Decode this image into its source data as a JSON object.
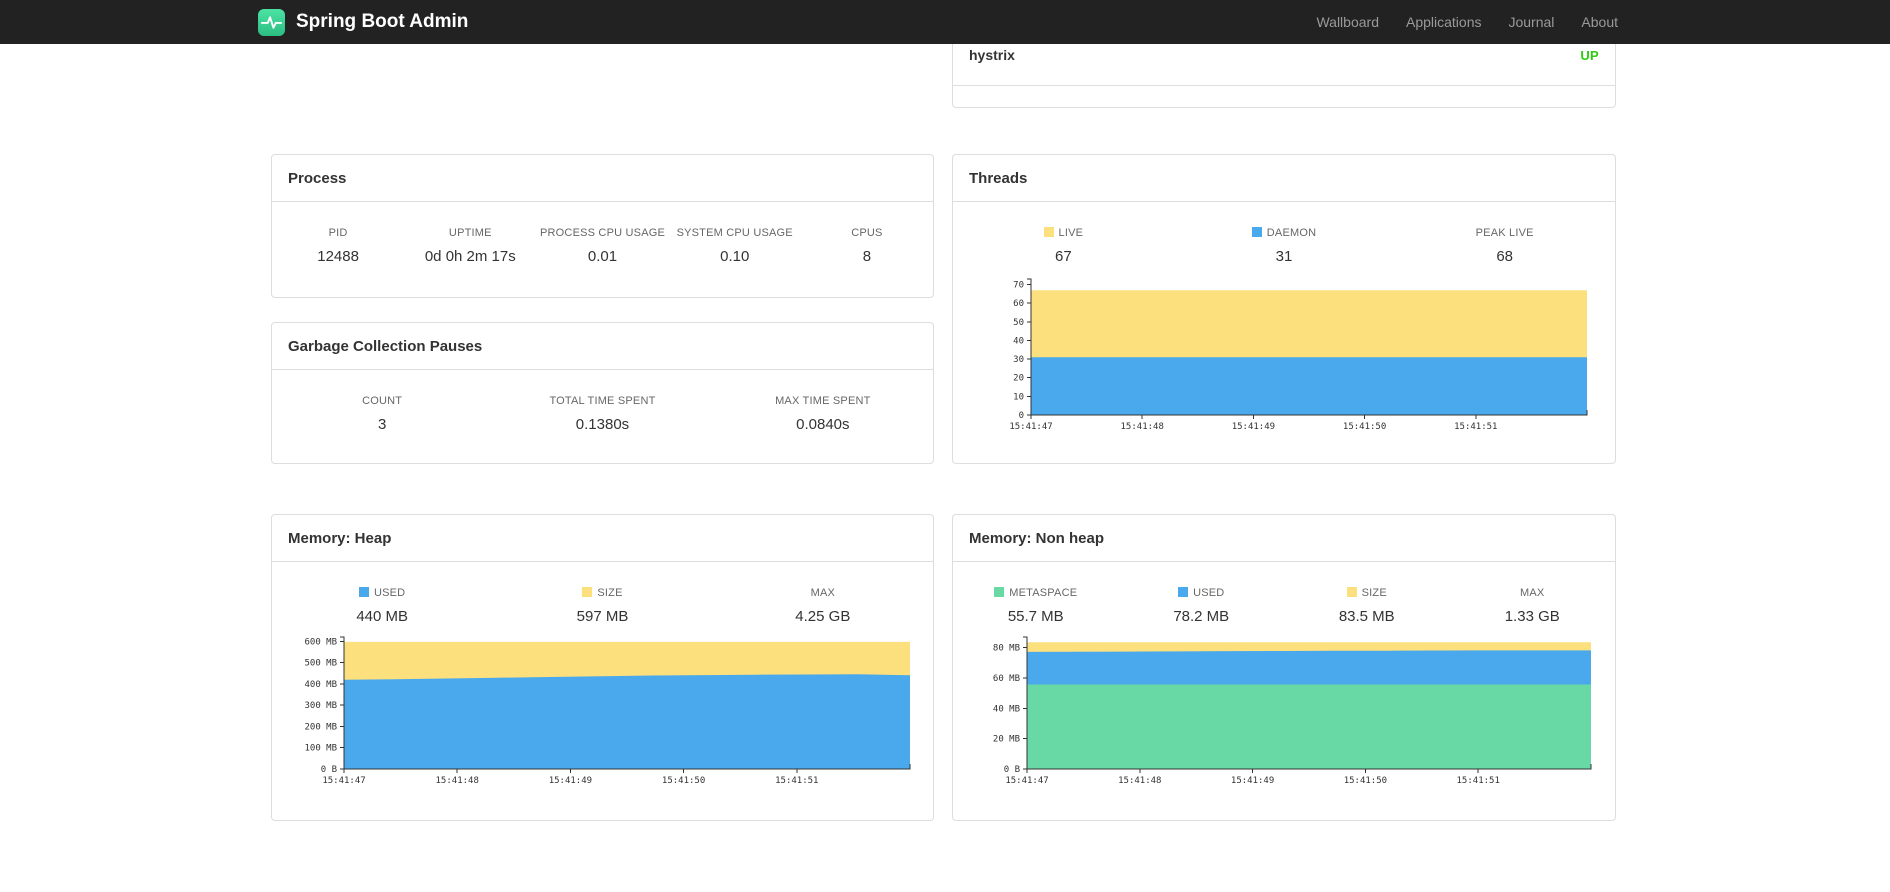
{
  "navbar": {
    "brand": "Spring Boot Admin",
    "links": [
      "Wallboard",
      "Applications",
      "Journal",
      "About"
    ]
  },
  "health": {
    "name": "hystrix",
    "status": "UP",
    "status_color": "#2ecc0e"
  },
  "process": {
    "title": "Process",
    "stats": [
      {
        "label": "PID",
        "value": "12488"
      },
      {
        "label": "UPTIME",
        "value": "0d 0h 2m 17s"
      },
      {
        "label": "PROCESS CPU USAGE",
        "value": "0.01"
      },
      {
        "label": "SYSTEM CPU USAGE",
        "value": "0.10"
      },
      {
        "label": "CPUS",
        "value": "8"
      }
    ]
  },
  "gc": {
    "title": "Garbage Collection Pauses",
    "stats": [
      {
        "label": "COUNT",
        "value": "3"
      },
      {
        "label": "TOTAL TIME SPENT",
        "value": "0.1380s"
      },
      {
        "label": "MAX TIME SPENT",
        "value": "0.0840s"
      }
    ]
  },
  "threads": {
    "title": "Threads",
    "legend": [
      {
        "label": "LIVE",
        "value": "67",
        "color": "#fce07e"
      },
      {
        "label": "DAEMON",
        "value": "31",
        "color": "#4aa9ec"
      },
      {
        "label": "PEAK LIVE",
        "value": "68"
      }
    ]
  },
  "heap": {
    "title": "Memory: Heap",
    "legend": [
      {
        "label": "USED",
        "value": "440 MB",
        "color": "#4aa9ec"
      },
      {
        "label": "SIZE",
        "value": "597 MB",
        "color": "#fce07e"
      },
      {
        "label": "MAX",
        "value": "4.25 GB"
      }
    ]
  },
  "nonheap": {
    "title": "Memory: Non heap",
    "legend": [
      {
        "label": "METASPACE",
        "value": "55.7 MB",
        "color": "#68d9a4"
      },
      {
        "label": "USED",
        "value": "78.2 MB",
        "color": "#4aa9ec"
      },
      {
        "label": "SIZE",
        "value": "83.5 MB",
        "color": "#fce07e"
      },
      {
        "label": "MAX",
        "value": "1.33 GB"
      }
    ]
  },
  "chart_data": [
    {
      "id": "threads",
      "type": "area",
      "title": "Threads",
      "ylim": [
        0,
        73
      ],
      "yticks": [
        {
          "v": 70,
          "label": "70"
        },
        {
          "v": 60,
          "label": "60"
        },
        {
          "v": 50,
          "label": "50"
        },
        {
          "v": 40,
          "label": "40"
        },
        {
          "v": 30,
          "label": "30"
        },
        {
          "v": 20,
          "label": "20"
        },
        {
          "v": 10,
          "label": "10"
        },
        {
          "v": 0,
          "label": "0"
        }
      ],
      "x_labels": [
        "15:41:47",
        "15:41:48",
        "15:41:49",
        "15:41:50",
        "15:41:51"
      ],
      "x_label_step_frac": 0.2,
      "series": [
        {
          "name": "LIVE",
          "color": "#fce07e",
          "values": [
            67,
            67,
            67,
            67,
            67,
            67,
            67,
            67,
            67,
            67,
            67,
            67
          ]
        },
        {
          "name": "DAEMON",
          "color": "#4aa9ec",
          "values": [
            31,
            31,
            31,
            31,
            31,
            31,
            31,
            31,
            31,
            31,
            31,
            31
          ]
        }
      ]
    },
    {
      "id": "heap",
      "type": "area",
      "title": "Memory: Heap",
      "ylim": [
        0,
        620
      ],
      "yticks": [
        {
          "v": 600,
          "label": "600 MB"
        },
        {
          "v": 500,
          "label": "500 MB"
        },
        {
          "v": 400,
          "label": "400 MB"
        },
        {
          "v": 300,
          "label": "300 MB"
        },
        {
          "v": 200,
          "label": "200 MB"
        },
        {
          "v": 100,
          "label": "100 MB"
        },
        {
          "v": 0,
          "label": "0 B"
        }
      ],
      "x_labels": [
        "15:41:47",
        "15:41:48",
        "15:41:49",
        "15:41:50",
        "15:41:51"
      ],
      "x_label_step_frac": 0.2,
      "series": [
        {
          "name": "SIZE",
          "color": "#fce07e",
          "values": [
            597,
            597,
            597,
            597,
            597,
            597,
            597,
            597,
            597,
            597,
            597,
            597
          ]
        },
        {
          "name": "USED",
          "color": "#4aa9ec",
          "values": [
            419,
            422,
            425,
            429,
            432,
            436,
            439,
            441,
            443,
            444,
            445,
            440
          ]
        }
      ]
    },
    {
      "id": "nonheap",
      "type": "area",
      "title": "Memory: Non heap",
      "ylim": [
        0,
        87
      ],
      "yticks": [
        {
          "v": 80,
          "label": "80 MB"
        },
        {
          "v": 60,
          "label": "60 MB"
        },
        {
          "v": 40,
          "label": "40 MB"
        },
        {
          "v": 20,
          "label": "20 MB"
        },
        {
          "v": 0,
          "label": "0 B"
        }
      ],
      "x_labels": [
        "15:41:47",
        "15:41:48",
        "15:41:49",
        "15:41:50",
        "15:41:51"
      ],
      "x_label_step_frac": 0.2,
      "series": [
        {
          "name": "SIZE",
          "color": "#fce07e",
          "values": [
            83.5,
            83.5,
            83.5,
            83.5,
            83.5,
            83.5,
            83.5,
            83.5,
            83.5,
            83.5,
            83.5,
            83.5
          ]
        },
        {
          "name": "USED",
          "color": "#4aa9ec",
          "values": [
            77.2,
            77.3,
            77.4,
            77.5,
            77.7,
            77.8,
            77.9,
            78.0,
            78.1,
            78.2,
            78.2,
            78.2
          ]
        },
        {
          "name": "METASPACE",
          "color": "#68d9a4",
          "values": [
            55.7,
            55.7,
            55.7,
            55.7,
            55.7,
            55.7,
            55.7,
            55.7,
            55.7,
            55.7,
            55.7,
            55.7
          ]
        }
      ]
    }
  ]
}
